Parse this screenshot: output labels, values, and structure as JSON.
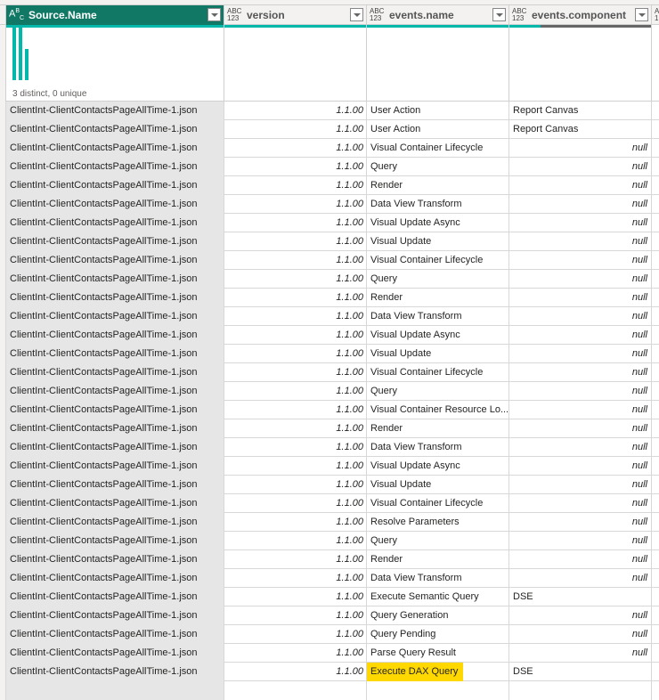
{
  "columns": [
    {
      "type": "ABC",
      "name": "Source.Name",
      "selected": true
    },
    {
      "type": "ABC 123",
      "name": "version"
    },
    {
      "type": "ABC 123",
      "name": "events.name"
    },
    {
      "type": "ABC 123",
      "name": "events.component"
    }
  ],
  "profile": {
    "summary": "3 distinct, 0 unique"
  },
  "colors": {
    "selected_header": "#117865",
    "valid": "#01b8aa",
    "empty": "#666666",
    "highlight": "#ffd800"
  },
  "source_value": "ClientInt-ClientContactsPageAllTime-1.json",
  "version_value": "1.1.00",
  "rows": [
    [
      "User Action",
      "Report Canvas"
    ],
    [
      "User Action",
      "Report Canvas"
    ],
    [
      "Visual Container Lifecycle",
      "null"
    ],
    [
      "Query",
      "null"
    ],
    [
      "Render",
      "null"
    ],
    [
      "Data View Transform",
      "null"
    ],
    [
      "Visual Update Async",
      "null"
    ],
    [
      "Visual Update",
      "null"
    ],
    [
      "Visual Container Lifecycle",
      "null"
    ],
    [
      "Query",
      "null"
    ],
    [
      "Render",
      "null"
    ],
    [
      "Data View Transform",
      "null"
    ],
    [
      "Visual Update Async",
      "null"
    ],
    [
      "Visual Update",
      "null"
    ],
    [
      "Visual Container Lifecycle",
      "null"
    ],
    [
      "Query",
      "null"
    ],
    [
      "Visual Container Resource Lo...",
      "null"
    ],
    [
      "Render",
      "null"
    ],
    [
      "Data View Transform",
      "null"
    ],
    [
      "Visual Update Async",
      "null"
    ],
    [
      "Visual Update",
      "null"
    ],
    [
      "Visual Container Lifecycle",
      "null"
    ],
    [
      "Resolve Parameters",
      "null"
    ],
    [
      "Query",
      "null"
    ],
    [
      "Render",
      "null"
    ],
    [
      "Data View Transform",
      "null"
    ],
    [
      "Execute Semantic Query",
      "DSE"
    ],
    [
      "Query Generation",
      "null"
    ],
    [
      "Query Pending",
      "null"
    ],
    [
      "Parse Query Result",
      "null"
    ],
    [
      "Execute DAX Query",
      "DSE"
    ]
  ]
}
